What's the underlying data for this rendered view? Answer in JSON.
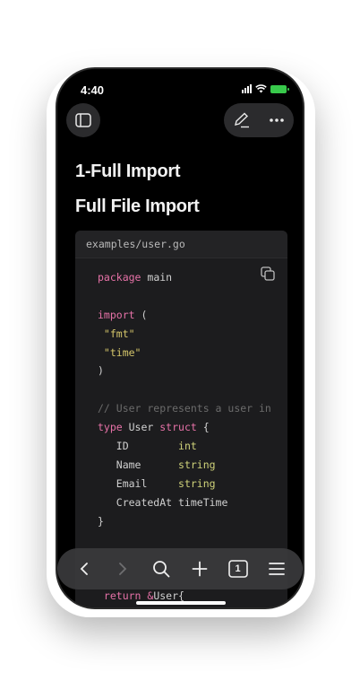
{
  "status": {
    "time": "4:40"
  },
  "page": {
    "heading1": "1-Full Import",
    "heading2": "Full File Import"
  },
  "code_block": {
    "filename": "examples/user.go",
    "lines": [
      [
        {
          "t": "package",
          "c": "kw"
        },
        {
          "t": " main",
          "c": ""
        }
      ],
      [],
      [
        {
          "t": "import",
          "c": "kw"
        },
        {
          "t": " (",
          "c": ""
        }
      ],
      [
        {
          "t": " \"fmt\"",
          "c": "str"
        }
      ],
      [
        {
          "t": " \"time\"",
          "c": "str"
        }
      ],
      [
        {
          "t": ")",
          "c": ""
        }
      ],
      [],
      [
        {
          "t": "// User represents a user in",
          "c": "cm"
        }
      ],
      [
        {
          "t": "type",
          "c": "kw"
        },
        {
          "t": " User ",
          "c": ""
        },
        {
          "t": "struct",
          "c": "kw"
        },
        {
          "t": " {",
          "c": ""
        }
      ],
      [
        {
          "t": "   ID        ",
          "c": ""
        },
        {
          "t": "int",
          "c": "typ"
        }
      ],
      [
        {
          "t": "   Name      ",
          "c": ""
        },
        {
          "t": "string",
          "c": "typ"
        }
      ],
      [
        {
          "t": "   Email     ",
          "c": ""
        },
        {
          "t": "string",
          "c": "typ"
        }
      ],
      [
        {
          "t": "   CreatedAt timeTime",
          "c": ""
        }
      ],
      [
        {
          "t": "}",
          "c": ""
        }
      ],
      [],
      [],
      [],
      [
        {
          "t": " return ",
          "c": "kw"
        },
        {
          "t": "&",
          "c": "kw"
        },
        {
          "t": "User{",
          "c": ""
        }
      ]
    ]
  },
  "toolbar": {
    "tab_count": "1"
  }
}
